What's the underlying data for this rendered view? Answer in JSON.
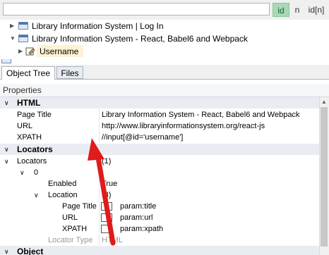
{
  "search": {
    "value": "",
    "placeholder": ""
  },
  "toggles": {
    "id": "id",
    "n": "n",
    "idn": "id[n]"
  },
  "tree": {
    "items": [
      {
        "label": "Library Information System | Log In"
      },
      {
        "label": "Library Information System - React, Babel6 and Webpack"
      },
      {
        "label": "Username"
      }
    ]
  },
  "tabs": [
    {
      "label": "Object Tree"
    },
    {
      "label": "Files"
    }
  ],
  "properties": {
    "header": "Properties",
    "html_cat": "HTML",
    "page_title_label": "Page Title",
    "page_title_value": "Library Information System - React, Babel6 and Webpack",
    "url_label": "URL",
    "url_value": "http://www.libraryinformationsystem.org/react-js",
    "xpath_label": "XPATH",
    "xpath_value": "//input[@id='username']",
    "locators_cat": "Locators",
    "locators_label": "Locators",
    "locators_value": "(1)",
    "item0_label": "0",
    "enabled_label": "Enabled",
    "enabled_value": "True",
    "location_label": "Location",
    "location_value": "(3)",
    "loc_pagetitle_label": "Page Title",
    "loc_pagetitle_value": "param:title",
    "loc_url_label": "URL",
    "loc_url_value": "param:url",
    "loc_xpath_label": "XPATH",
    "loc_xpath_value": "param:xpath",
    "locator_type_label": "Locator Type",
    "locator_type_value": "HTML",
    "object_cat": "Object"
  },
  "colors": {
    "toggle_active": "#a8d8b4",
    "annotation_arrow": "#e01b1b",
    "selection": "#fdf3d4"
  }
}
